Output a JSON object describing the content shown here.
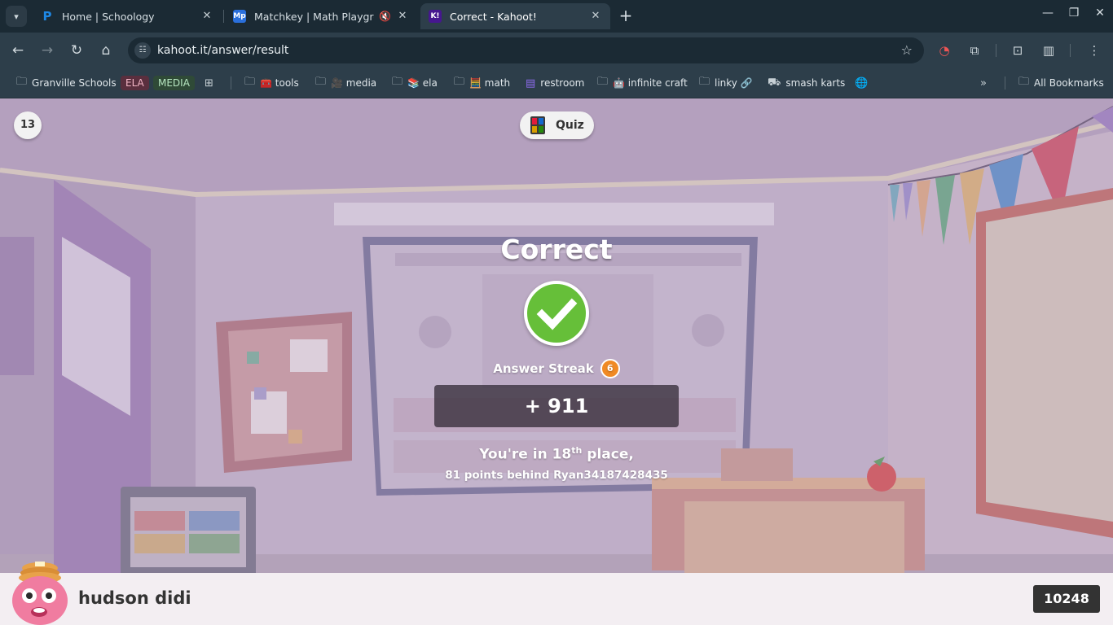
{
  "browser": {
    "tabs": [
      {
        "favicon": "P",
        "title": "Home | Schoology",
        "muted": false,
        "active": false
      },
      {
        "favicon": "Mp",
        "title": "Matchkey | Math Playground",
        "muted": true,
        "active": false
      },
      {
        "favicon": "K!",
        "title": "Correct - Kahoot!",
        "muted": false,
        "active": true
      }
    ],
    "url": "kahoot.it/answer/result",
    "bookmarks": [
      {
        "label": "Granville Schools",
        "icon": "folder-settings-icon"
      },
      {
        "label": "ELA",
        "icon": "chip"
      },
      {
        "label": "MEDIA",
        "icon": "chip"
      },
      {
        "label": "",
        "icon": "grid-icon"
      },
      {
        "label": "🧰 tools",
        "icon": "folder-icon"
      },
      {
        "label": "🎥 media",
        "icon": "folder-icon"
      },
      {
        "label": "📚 ela",
        "icon": "folder-icon"
      },
      {
        "label": "🧮 math",
        "icon": "folder-icon"
      },
      {
        "label": "restroom",
        "icon": "form-icon"
      },
      {
        "label": "🤖 infinite craft",
        "icon": "folder-icon"
      },
      {
        "label": "linky 🔗",
        "icon": "folder-icon"
      },
      {
        "label": "smash karts",
        "icon": "kart-icon"
      },
      {
        "label": "",
        "icon": "globe-icon"
      }
    ],
    "all_bookmarks": "All Bookmarks"
  },
  "quiz": {
    "question_number": "13",
    "mode_label": "Quiz",
    "result_title": "Correct",
    "streak_label": "Answer Streak",
    "streak_count": "6",
    "points": "+ 911",
    "place_prefix": "You're in 18",
    "place_suffix_sup": "th",
    "place_suffix": " place,",
    "behind_text": "81 points behind Ryan34187428435",
    "player_name": "hudson didi",
    "total_score": "10248"
  },
  "colors": {
    "correct_green": "#66bf39",
    "streak_orange": "#f08a24",
    "footer_bg": "#f3eef2",
    "score_bg": "#333333"
  }
}
